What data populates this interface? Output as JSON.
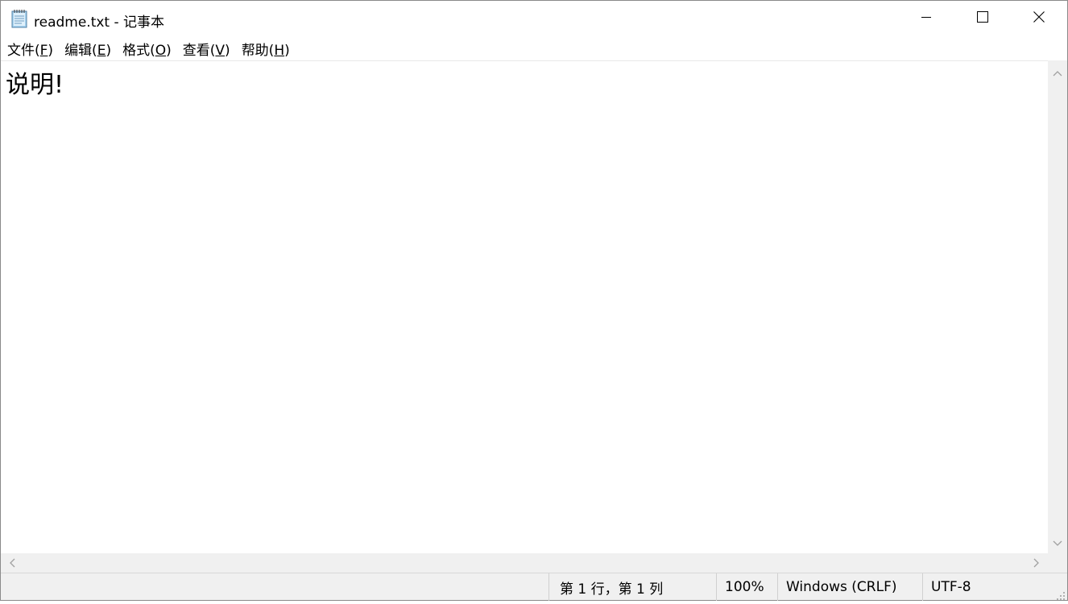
{
  "window": {
    "title": "readme.txt - 记事本"
  },
  "icons": {
    "app": "notepad-icon",
    "minimize": "minimize-icon",
    "maximize": "maximize-icon",
    "close": "close-icon",
    "scroll_up": "chevron-up-icon",
    "scroll_down": "chevron-down-icon",
    "scroll_left": "chevron-left-icon",
    "scroll_right": "chevron-right-icon",
    "size_grip": "resize-grip-icon"
  },
  "menu": {
    "items": [
      {
        "label": "文件(",
        "key": "F",
        "suffix": ")"
      },
      {
        "label": "编辑(",
        "key": "E",
        "suffix": ")"
      },
      {
        "label": "格式(",
        "key": "O",
        "suffix": ")"
      },
      {
        "label": "查看(",
        "key": "V",
        "suffix": ")"
      },
      {
        "label": "帮助(",
        "key": "H",
        "suffix": ")"
      }
    ]
  },
  "editor": {
    "content": "说明!"
  },
  "status": {
    "position": "第 1 行，第 1 列",
    "zoom": "100%",
    "line_ending": "Windows (CRLF)",
    "encoding": "UTF-8"
  },
  "colors": {
    "window_bg": "#ffffff",
    "chrome_bg": "#f0f0f0",
    "text": "#000000",
    "close_hover": "#e81123"
  }
}
